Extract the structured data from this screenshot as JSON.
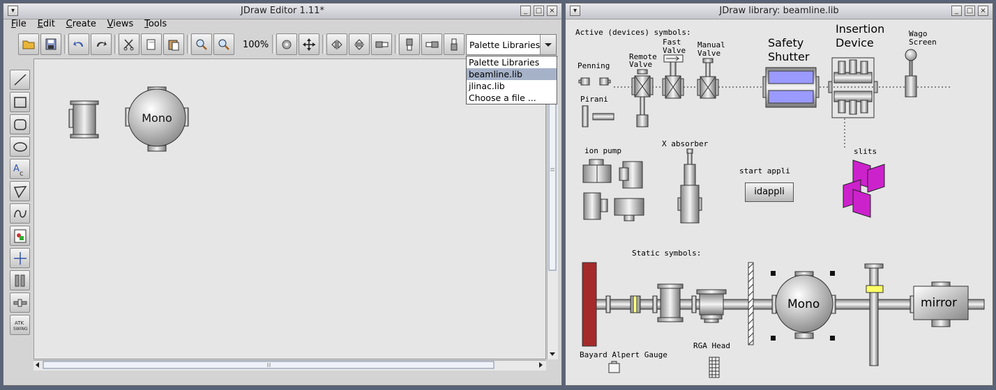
{
  "editor": {
    "title": "JDraw Editor 1.11*",
    "menu": [
      "File",
      "Edit",
      "Create",
      "Views",
      "Tools"
    ],
    "zoom": "100%",
    "palette_combo": {
      "value": "Palette Libraries",
      "options": [
        "Palette Libraries",
        "beamline.lib",
        "jlinac.lib",
        "Choose a file ..."
      ],
      "selected": "beamline.lib"
    },
    "canvas_objects": {
      "mono_label": "Mono"
    },
    "toolbar_icons": [
      "open-folder-icon",
      "save-icon",
      "undo-icon",
      "redo-icon",
      "cut-icon",
      "copy-icon",
      "paste-icon",
      "zoom-in-icon",
      "zoom-out-icon",
      "settings-icon",
      "move-icon",
      "flip-horizontal-icon",
      "flip-vertical-icon",
      "align-left-icon",
      "align-top-icon",
      "align-right-icon",
      "align-bottom-icon"
    ],
    "side_tools": [
      "line-icon",
      "rectangle-icon",
      "round-rectangle-icon",
      "ellipse-icon",
      "text-icon",
      "polygon-icon",
      "spline-icon",
      "image-icon",
      "axis-icon",
      "bar-icon",
      "slider-icon",
      "atk-swing-icon"
    ],
    "atk_label_1": "ATK",
    "atk_label_2": "SWING"
  },
  "library": {
    "title": "JDraw library: beamline.lib",
    "labels": {
      "active": "Active (devices) symbols:",
      "penning": "Penning",
      "pirani": "Pirani",
      "remote_valve_1": "Remote",
      "remote_valve_2": "Valve",
      "fast_valve_1": "Fast",
      "fast_valve_2": "Valve",
      "manual_valve_1": "Manual",
      "manual_valve_2": "Valve",
      "safety_1": "Safety",
      "safety_2": "Shutter",
      "insertion_1": "Insertion",
      "insertion_2": "Device",
      "wago_1": "Wago",
      "wago_2": "Screen",
      "ion_pump": "ion pump",
      "x_absorber": "X absorber",
      "start_appli": "start appli",
      "idappli": "idappli",
      "slits": "slits",
      "static": "Static symbols:",
      "bayard": "Bayard Alpert Gauge",
      "rga": "RGA Head",
      "mono": "Mono",
      "mirror": "mirror"
    }
  },
  "colors": {
    "titlebar": "#d0d2d8",
    "panel": "#d4d4d4",
    "canvas": "#e6e6e6",
    "shutter_blue": "#9a9aff",
    "slits_magenta": "#cc22cc",
    "dark_red": "#a52a2a"
  }
}
